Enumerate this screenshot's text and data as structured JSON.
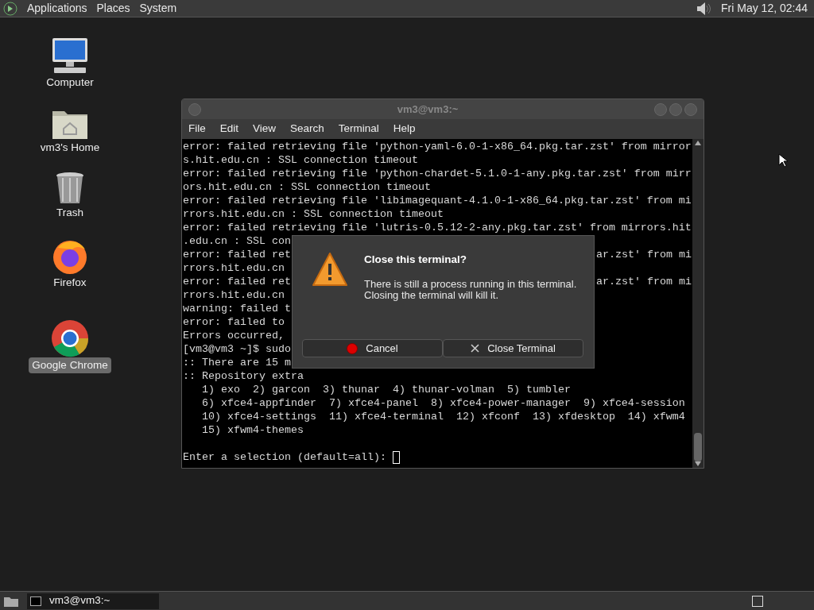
{
  "top_panel": {
    "menus": [
      "Applications",
      "Places",
      "System"
    ],
    "clock": "Fri May 12, 02:44"
  },
  "desktop_icons": [
    {
      "kind": "computer",
      "label": "Computer",
      "selected": false
    },
    {
      "kind": "home",
      "label": "vm3's Home",
      "selected": false
    },
    {
      "kind": "trash",
      "label": "Trash",
      "selected": false
    },
    {
      "kind": "firefox",
      "label": "Firefox",
      "selected": false
    },
    {
      "kind": "chrome",
      "label": "Google Chrome",
      "selected": true
    }
  ],
  "terminal": {
    "title": "vm3@vm3:~",
    "menu": [
      "File",
      "Edit",
      "View",
      "Search",
      "Terminal",
      "Help"
    ],
    "lines": [
      {
        "left": "error: failed retrieving file 'python-yaml-6.0-1-x86_64.pkg.tar.zst' from mirror"
      },
      {
        "left": "s.hit.edu.cn : SSL connection timeout"
      },
      {
        "left": "error: failed retrieving file 'python-chardet-5.1.0-1-any.pkg.tar.zst' from mirr"
      },
      {
        "left": "ors.hit.edu.cn : SSL connection timeout"
      },
      {
        "left": "error: failed retrieving file 'libimagequant-4.1.0-1-x86_64.pkg.tar.zst' from mi"
      },
      {
        "left": "rrors.hit.edu.cn : SSL connection timeout"
      },
      {
        "left": "error: failed retrieving file 'lutris-0.5.12-2-any.pkg.tar.zst' from mirrors.hit"
      },
      {
        "left": ".edu.cn : SSL con"
      },
      {
        "left": "error: failed ret",
        "right": "ar.zst' from mi"
      },
      {
        "left": "rrors.hit.edu.cn"
      },
      {
        "left": "error: failed ret",
        "right": "ar.zst' from mi"
      },
      {
        "left": "rrors.hit.edu.cn"
      },
      {
        "left": "warning: failed t"
      },
      {
        "left": "error: failed to"
      },
      {
        "left": "Errors occurred,"
      },
      {
        "left": "[vm3@vm3 ~]$ sudo"
      },
      {
        "left": ":: There are 15 m"
      },
      {
        "left": ":: Repository extra"
      },
      {
        "left": "   1) exo  2) garcon  3) thunar  4) thunar-volman  5) tumbler"
      },
      {
        "left": "   6) xfce4-appfinder  7) xfce4-panel  8) xfce4-power-manager  9) xfce4-session"
      },
      {
        "left": "   10) xfce4-settings  11) xfce4-terminal  12) xfconf  13) xfdesktop  14) xfwm4"
      },
      {
        "left": "   15) xfwm4-themes"
      },
      {
        "kind": "prompt",
        "left": "Enter a selection (default=all): "
      }
    ]
  },
  "dialog": {
    "title": "Close this terminal?",
    "message": "There is still a process running in this terminal.\nClosing the terminal will kill it.",
    "buttons": [
      {
        "kind": "cancel",
        "label": "Cancel"
      },
      {
        "kind": "close",
        "label": "Close Terminal"
      }
    ]
  },
  "taskbar": {
    "tasks": [
      {
        "label": "vm3@vm3:~",
        "selected": true
      }
    ]
  }
}
